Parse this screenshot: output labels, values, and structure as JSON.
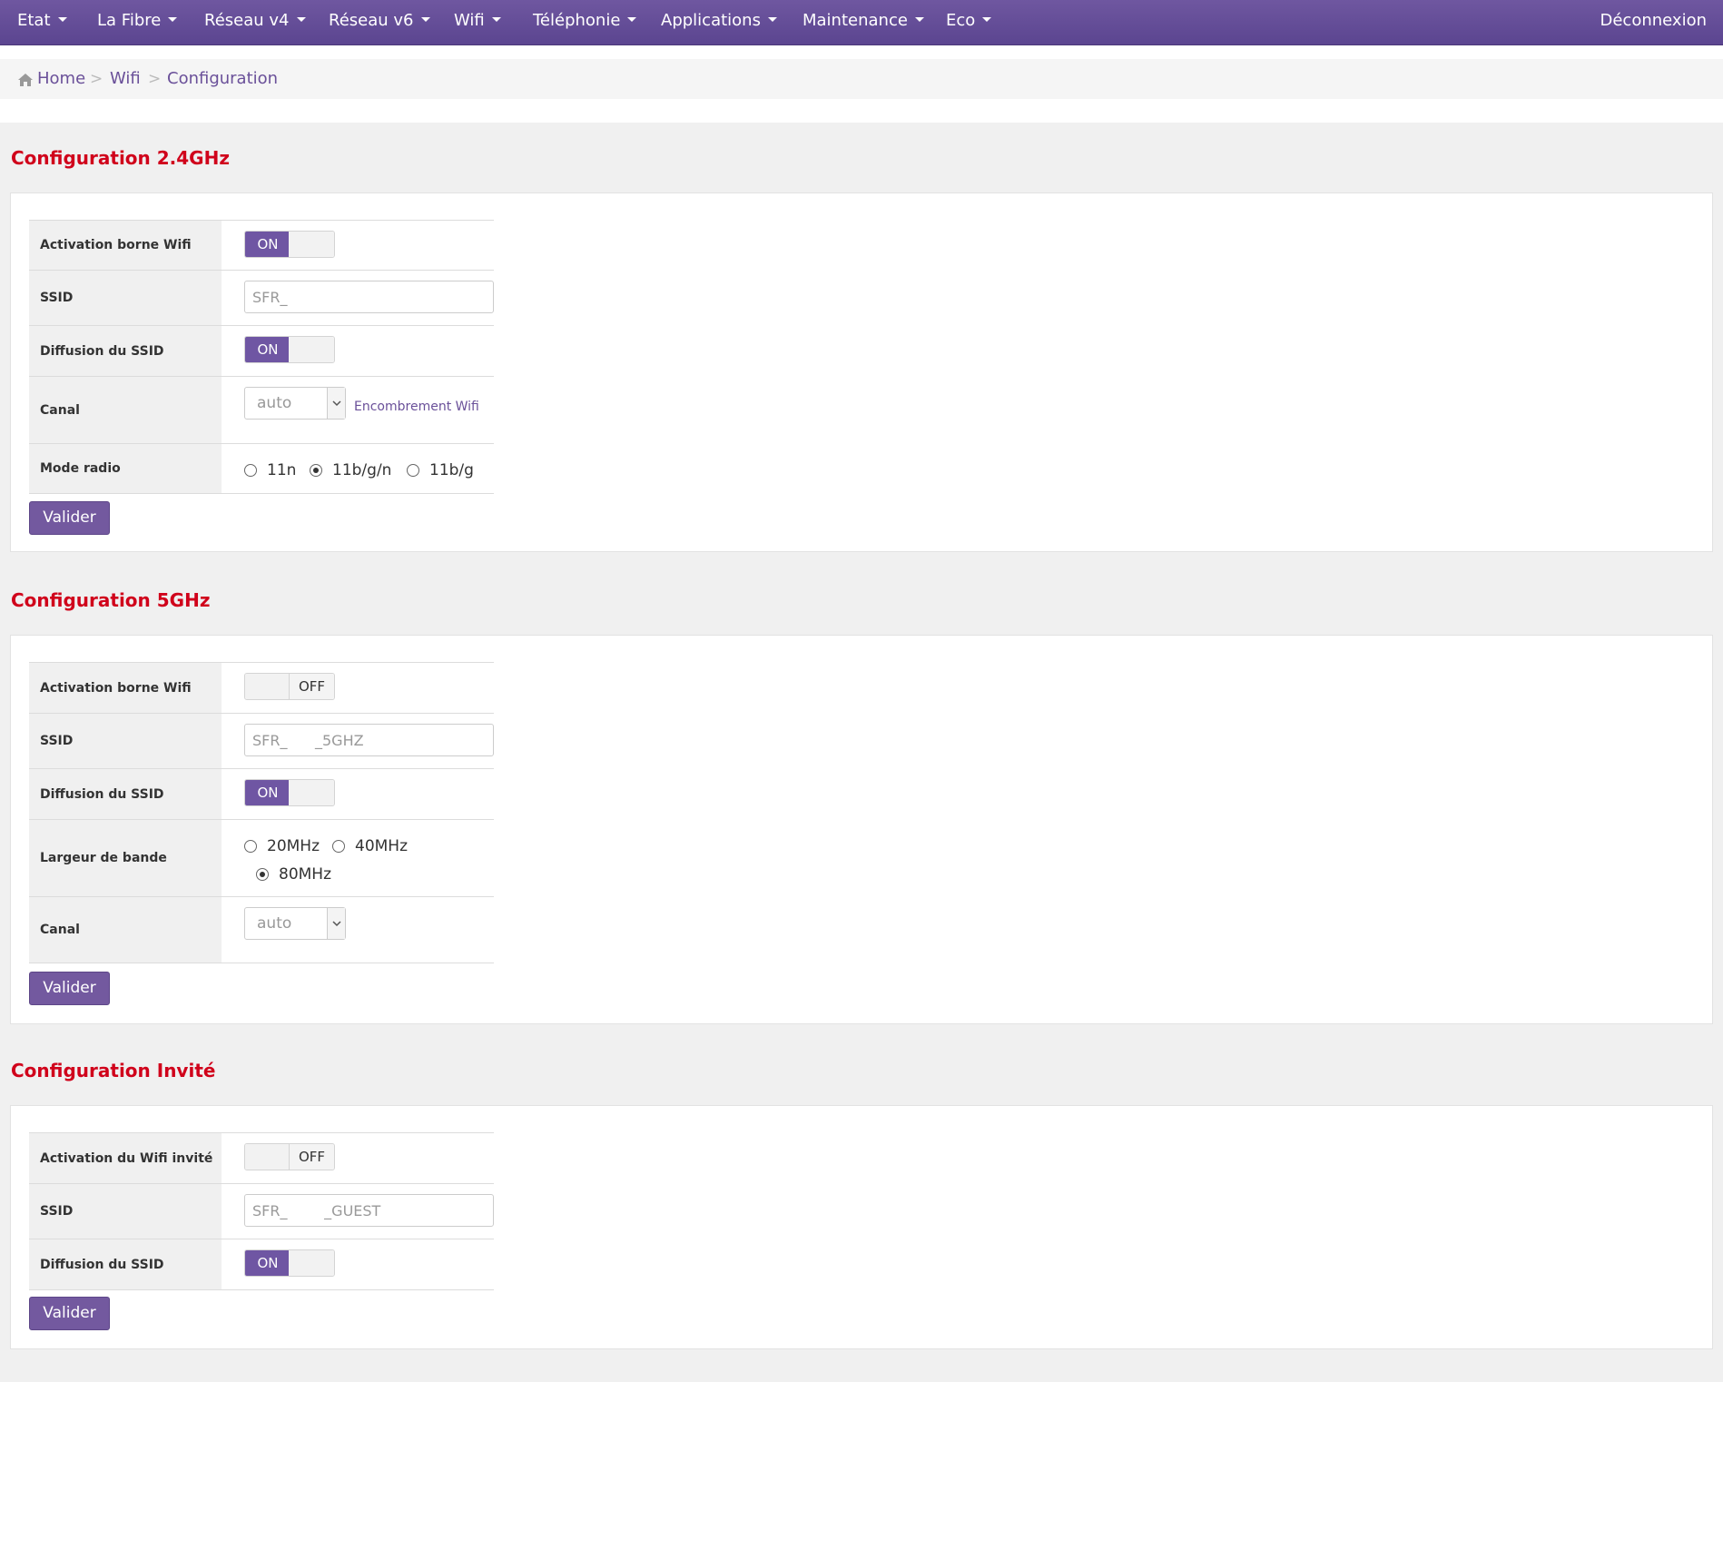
{
  "nav": {
    "items": [
      {
        "label": "Etat"
      },
      {
        "label": "La Fibre"
      },
      {
        "label": "Réseau v4"
      },
      {
        "label": "Réseau v6"
      },
      {
        "label": "Wifi"
      },
      {
        "label": "Téléphonie"
      },
      {
        "label": "Applications"
      },
      {
        "label": "Maintenance"
      },
      {
        "label": "Eco"
      }
    ],
    "logout": "Déconnexion"
  },
  "breadcrumb": {
    "home": "Home",
    "wifi": "Wifi",
    "current": "Configuration",
    "separator": ">"
  },
  "colors": {
    "brand": "#6f56a3",
    "title_red": "#d0021b"
  },
  "section24": {
    "title": "Configuration 2.4GHz",
    "activation_label": "Activation borne Wifi",
    "activation_state": "ON",
    "ssid_label": "SSID",
    "ssid_value": "SFR_",
    "broadcast_label": "Diffusion du SSID",
    "broadcast_state": "ON",
    "channel_label": "Canal",
    "channel_value": "auto",
    "congestion_link": "Encombrement Wifi",
    "mode_label": "Mode radio",
    "mode_options": [
      "11n",
      "11b/g/n",
      "11b/g"
    ],
    "mode_selected": "11b/g/n",
    "submit": "Valider"
  },
  "section5": {
    "title": "Configuration 5GHz",
    "activation_label": "Activation borne Wifi",
    "activation_state": "OFF",
    "ssid_label": "SSID",
    "ssid_value": "SFR_      _5GHZ",
    "broadcast_label": "Diffusion du SSID",
    "broadcast_state": "ON",
    "bandwidth_label": "Largeur de bande",
    "bandwidth_options": [
      "20MHz",
      "40MHz",
      "80MHz"
    ],
    "bandwidth_selected": "80MHz",
    "channel_label": "Canal",
    "channel_value": "auto",
    "submit": "Valider"
  },
  "guest": {
    "title": "Configuration Invité",
    "activation_label": "Activation du Wifi invité",
    "activation_state": "OFF",
    "ssid_label": "SSID",
    "ssid_value": "SFR_        _GUEST",
    "broadcast_label": "Diffusion du SSID",
    "broadcast_state": "ON",
    "submit": "Valider"
  }
}
